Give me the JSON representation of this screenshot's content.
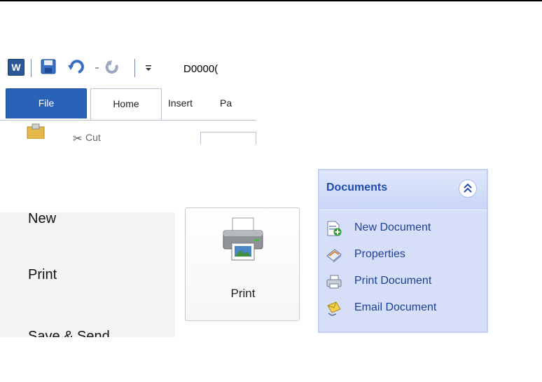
{
  "word": {
    "title_fragment": "D0000(",
    "tabs": {
      "file": "File",
      "home": "Home",
      "insert": "Insert",
      "pa": "Pa"
    },
    "clipboard": {
      "cut_label": "Cut"
    },
    "icons": [
      "word-logo-icon",
      "save-icon",
      "undo-icon",
      "redo-icon",
      "customize-quick-access-icon",
      "paste-icon",
      "scissors-icon"
    ]
  },
  "file_menu": {
    "items": [
      "New",
      "Print",
      "Save & Send"
    ]
  },
  "print_button": {
    "label": "Print",
    "icon": "printer-icon"
  },
  "documents_panel": {
    "title": "Documents",
    "items": [
      {
        "label": "New Document",
        "icon": "new-document-icon"
      },
      {
        "label": "Properties",
        "icon": "properties-icon"
      },
      {
        "label": "Print Document",
        "icon": "print-document-icon"
      },
      {
        "label": "Email Document",
        "icon": "email-document-icon"
      }
    ],
    "colors": {
      "title": "#1f4ba8",
      "background": "#d6dff7",
      "link": "#1d3f94"
    }
  }
}
